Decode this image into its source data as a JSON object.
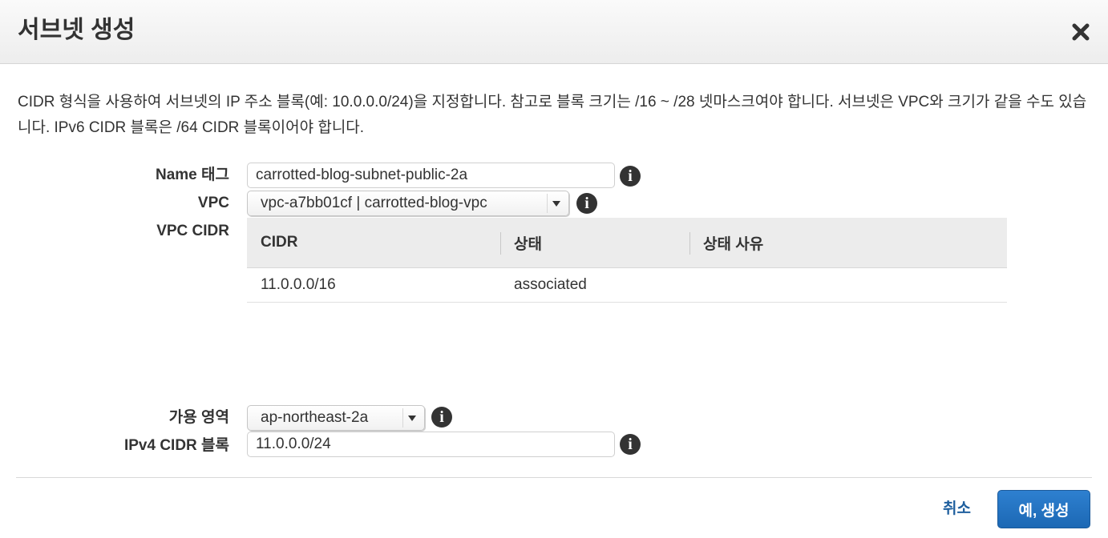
{
  "dialog": {
    "title": "서브넷 생성",
    "close_icon": "close-x-icon",
    "description": "CIDR 형식을 사용하여 서브넷의 IP 주소 블록(예: 10.0.0.0/24)을 지정합니다. 참고로 블록 크기는 /16 ~ /28 넷마스크여야 합니다. 서브넷은 VPC와 크기가 같을 수도 있습니다. IPv6 CIDR 블록은 /64 CIDR 블록이어야 합니다."
  },
  "form": {
    "name_tag": {
      "label": "Name 태그",
      "value": "carrotted-blog-subnet-public-2a",
      "info_icon": "info-icon"
    },
    "vpc": {
      "label": "VPC",
      "selected": "vpc-a7bb01cf | carrotted-blog-vpc",
      "info_icon": "info-icon"
    },
    "vpc_cidr": {
      "label": "VPC CIDR",
      "columns": [
        "CIDR",
        "상태",
        "상태 사유"
      ],
      "rows": [
        {
          "cidr": "11.0.0.0/16",
          "status": "associated",
          "reason": ""
        }
      ]
    },
    "availability_zone": {
      "label": "가용 영역",
      "selected": "ap-northeast-2a",
      "info_icon": "info-icon"
    },
    "ipv4_cidr": {
      "label": "IPv4 CIDR 블록",
      "value": "11.0.0.0/24",
      "info_icon": "info-icon"
    }
  },
  "footer": {
    "cancel_label": "취소",
    "confirm_label": "예, 생성"
  },
  "colors": {
    "status_associated": "#1d8f2f",
    "primary_button": "#1f6fbf",
    "link": "#1f5f9e"
  }
}
